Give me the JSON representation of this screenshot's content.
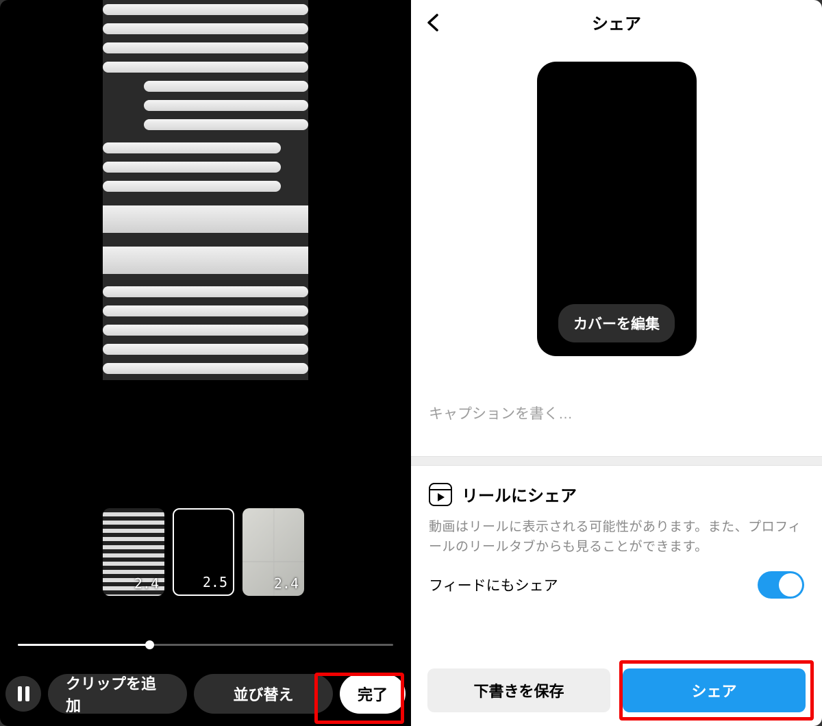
{
  "left": {
    "clips": [
      {
        "duration": "2.4"
      },
      {
        "duration": "2.5"
      },
      {
        "duration": "2.4"
      }
    ],
    "buttons": {
      "add_clip": "クリップを追加",
      "reorder": "並び替え",
      "done": "完了"
    }
  },
  "right": {
    "header_title": "シェア",
    "cover_edit": "カバーを編集",
    "caption_placeholder": "キャプションを書く…",
    "reels_section": {
      "title": "リールにシェア",
      "description": "動画はリールに表示される可能性があります。また、プロフィールのリールタブからも見ることができます。"
    },
    "feed_toggle_label": "フィードにもシェア",
    "feed_toggle_on": true,
    "draft_button": "下書きを保存",
    "share_button": "シェア"
  },
  "colors": {
    "accent": "#1e9bf0",
    "highlight": "#f20000"
  }
}
